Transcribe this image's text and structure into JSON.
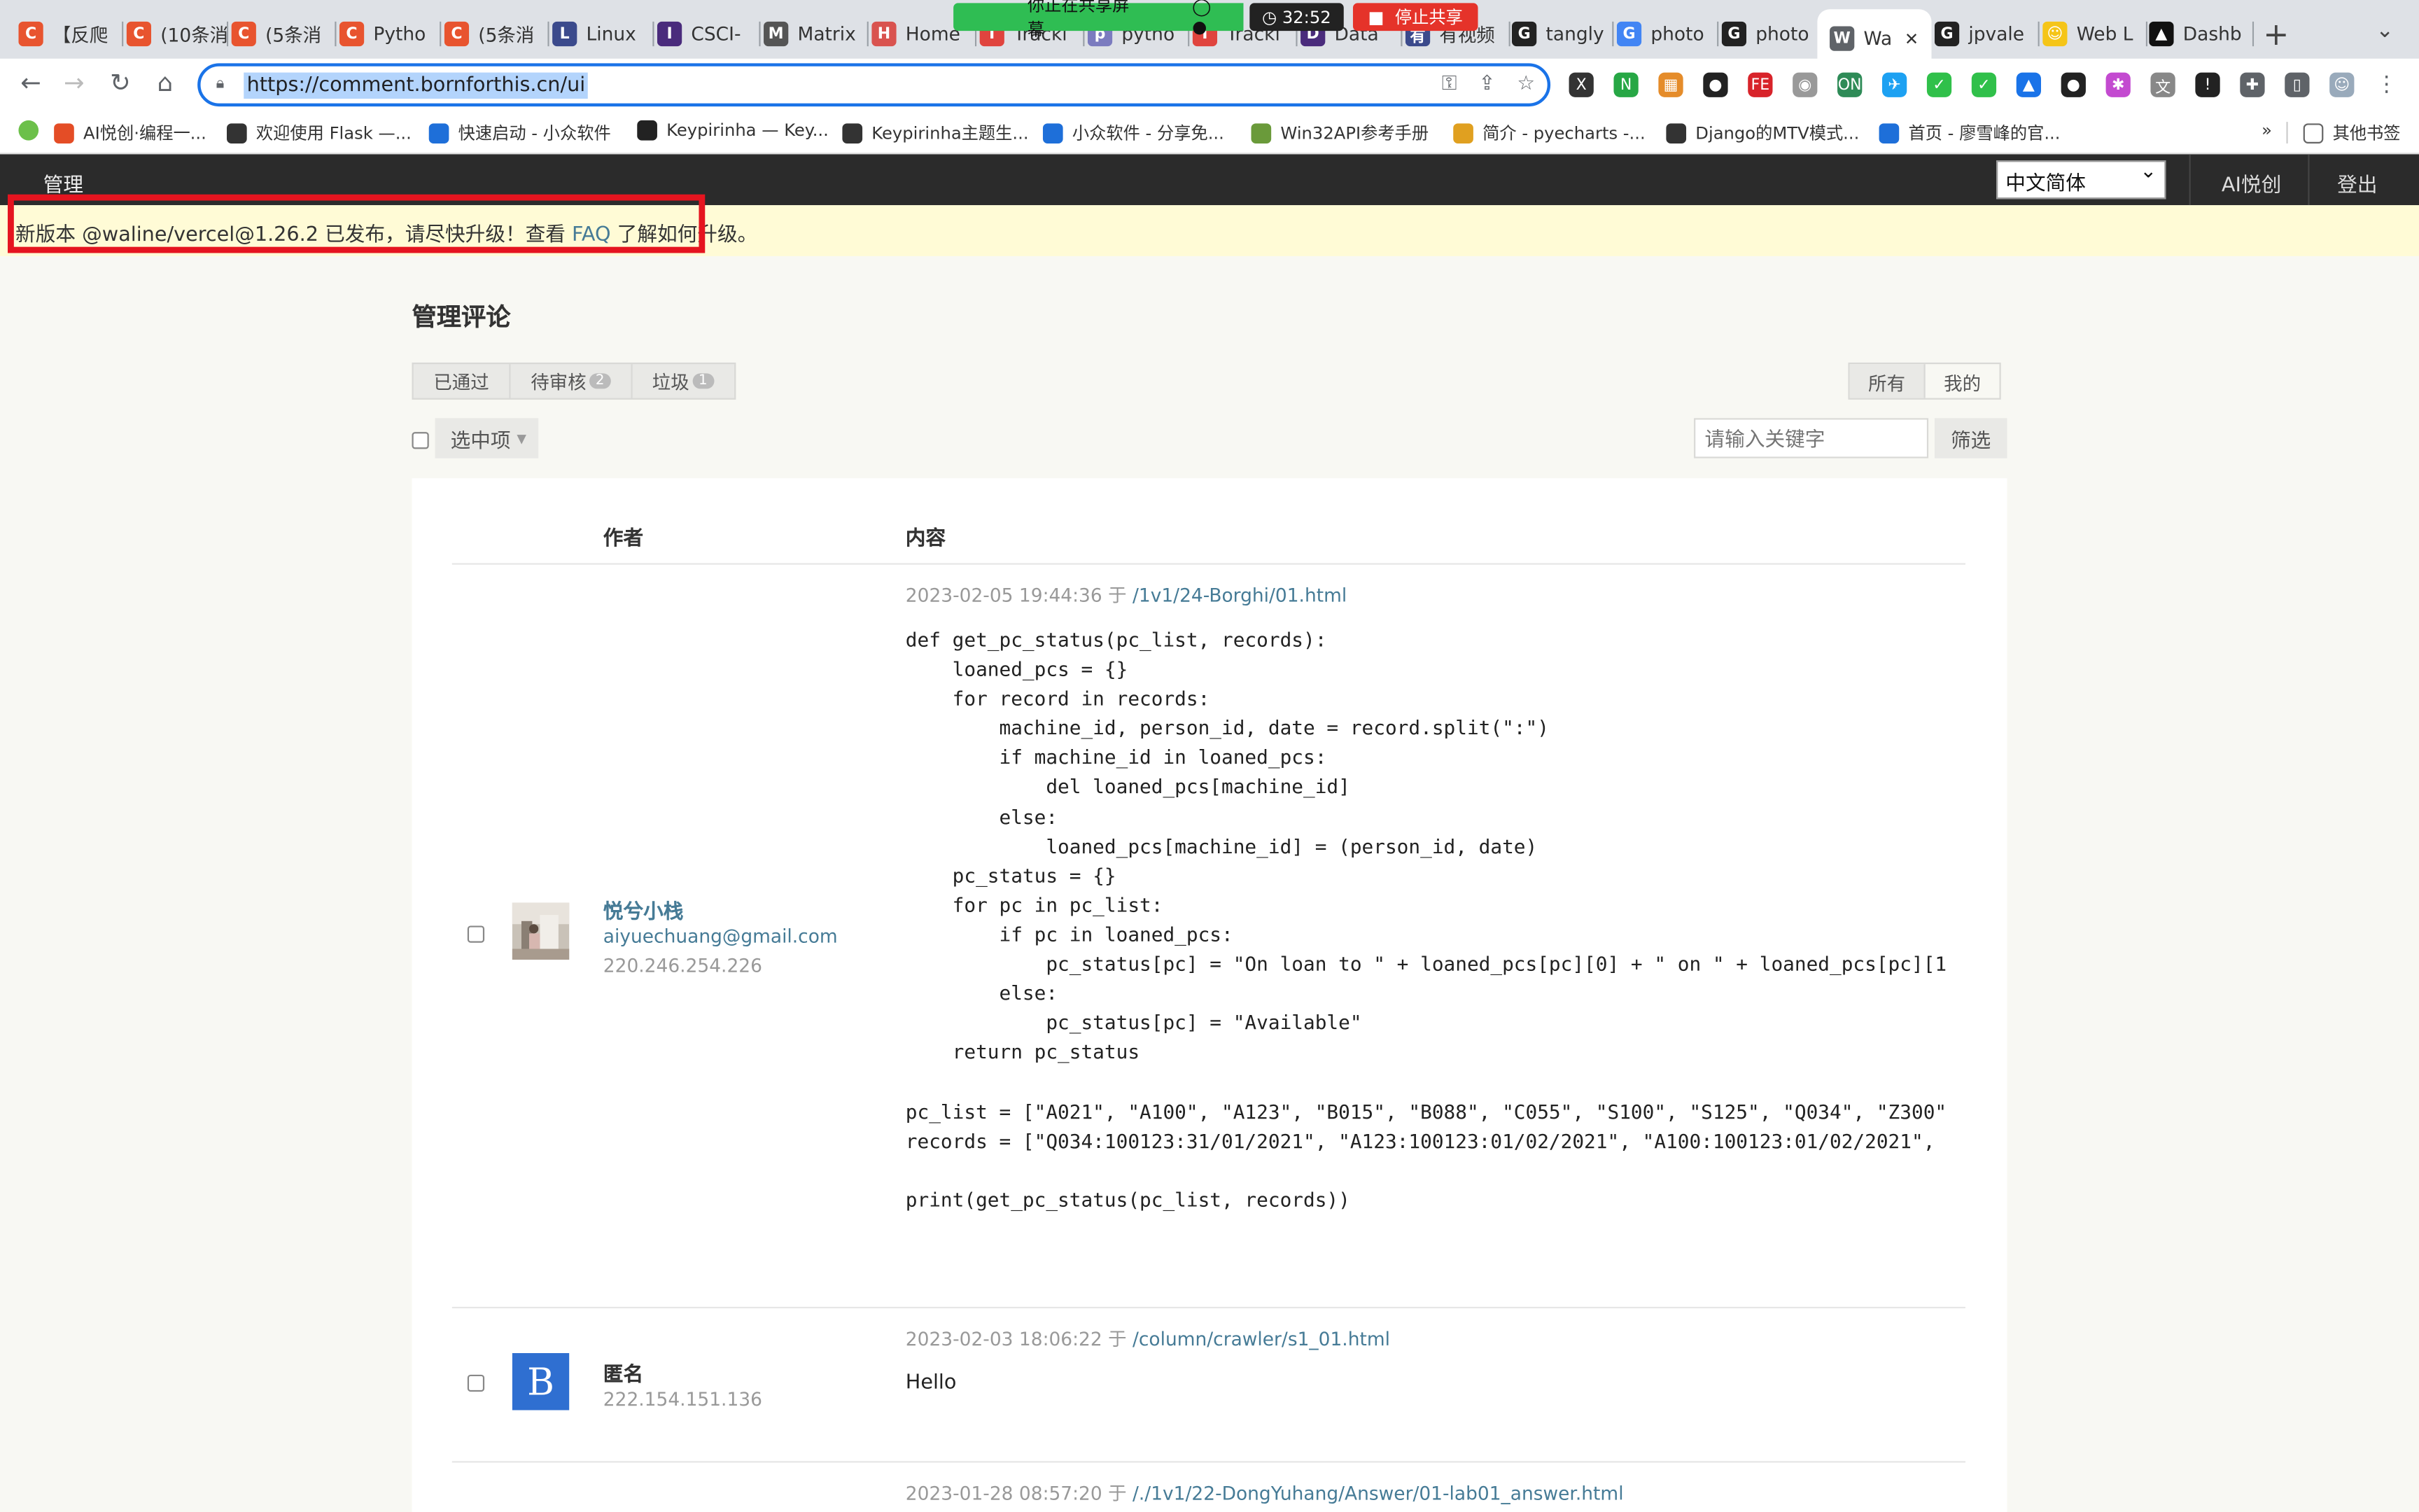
{
  "browser": {
    "tabs": [
      {
        "label": "【反爬",
        "color": "#e8542f",
        "glyph": "C"
      },
      {
        "label": "(10条消",
        "color": "#e8542f",
        "glyph": "C"
      },
      {
        "label": "(5条消",
        "color": "#e8542f",
        "glyph": "C"
      },
      {
        "label": "Pytho",
        "color": "#e8542f",
        "glyph": "C"
      },
      {
        "label": "(5条消",
        "color": "#e8542f",
        "glyph": "C"
      },
      {
        "label": "Linux",
        "color": "#3b4a8c",
        "glyph": "L"
      },
      {
        "label": "CSCI-",
        "color": "#4a2b7c",
        "glyph": "I"
      },
      {
        "label": "Matrix",
        "color": "#555555",
        "glyph": "M"
      },
      {
        "label": "Home",
        "color": "#d9534f",
        "glyph": "H"
      },
      {
        "label": "Tracki",
        "color": "#e0443e",
        "glyph": "T"
      },
      {
        "label": "pytho",
        "color": "#7b7bbf",
        "glyph": "p"
      },
      {
        "label": "Tracki",
        "color": "#e0443e",
        "glyph": "T"
      },
      {
        "label": "Data",
        "color": "#4a2b7c",
        "glyph": "D"
      },
      {
        "label": "有视频",
        "color": "#3b4a8c",
        "glyph": "有"
      },
      {
        "label": "tangly",
        "color": "#222222",
        "glyph": "G"
      },
      {
        "label": "photo",
        "color": "#4285f4",
        "glyph": "G"
      },
      {
        "label": "photo",
        "color": "#222222",
        "glyph": "G"
      },
      {
        "label": "Wa",
        "color": "#5f6368",
        "glyph": "W"
      },
      {
        "label": "jpvale",
        "color": "#222222",
        "glyph": "G"
      },
      {
        "label": "Web L",
        "color": "#f5c518",
        "glyph": "☺"
      },
      {
        "label": "Dashb",
        "color": "#111111",
        "glyph": "▲"
      }
    ],
    "new_tab": "+",
    "share_bar": {
      "message": "你正在共享屏幕",
      "timer": "32:52",
      "stop": "停止共享"
    },
    "url": "https://comment.bornforthis.cn/ui",
    "bookmarks": [
      {
        "label": "AI悦创·编程一...",
        "color": "#e44d26"
      },
      {
        "label": "欢迎使用 Flask —...",
        "color": "#333333"
      },
      {
        "label": "快速启动 - 小众软件",
        "color": "#1e6fd9"
      },
      {
        "label": "Keypirinha — Key...",
        "color": "#222222"
      },
      {
        "label": "Keypirinha主题生...",
        "color": "#333333"
      },
      {
        "label": "小众软件 - 分享免...",
        "color": "#1e6fd9"
      },
      {
        "label": "Win32API参考手册",
        "color": "#6a9a3a"
      },
      {
        "label": "简介 - pyecharts -...",
        "color": "#e0a020"
      },
      {
        "label": "Django的MTV模式...",
        "color": "#333333"
      },
      {
        "label": "首页 - 廖雪峰的官...",
        "color": "#1e6fd9"
      }
    ],
    "bookmarks_more": "»",
    "other_bookmarks": "其他书签"
  },
  "admin": {
    "brand": "管理",
    "language": "中文简体",
    "site_link": "AI悦创",
    "logout": "登出"
  },
  "notice": {
    "prefix": "新版本 @waline/vercel@1.26.2 已发布，请尽快升级！查看 ",
    "link": "FAQ",
    "suffix": " 了解如何升级。"
  },
  "page": {
    "title": "管理评论",
    "status_tabs": [
      {
        "label": "已通过",
        "count": ""
      },
      {
        "label": "待审核",
        "count": "2"
      },
      {
        "label": "垃圾",
        "count": "1"
      }
    ],
    "scope_tabs": [
      "所有",
      "我的"
    ],
    "select_label": "选中项",
    "search_placeholder": "请输入关键字",
    "filter_label": "筛选",
    "columns": {
      "author": "作者",
      "content": "内容"
    }
  },
  "comments": [
    {
      "name": "悦兮小栈",
      "email": "aiyuechuang@gmail.com",
      "ip": "220.246.254.226",
      "date": "2023-02-05 19:44:36 于 ",
      "path": "/1v1/24-Borghi/01.html",
      "code": "def get_pc_status(pc_list, records):\n    loaned_pcs = {}\n    for record in records:\n        machine_id, person_id, date = record.split(\":\")\n        if machine_id in loaned_pcs:\n            del loaned_pcs[machine_id]\n        else:\n            loaned_pcs[machine_id] = (person_id, date)\n    pc_status = {}\n    for pc in pc_list:\n        if pc in loaned_pcs:\n            pc_status[pc] = \"On loan to \" + loaned_pcs[pc][0] + \" on \" + loaned_pcs[pc][1\n        else:\n            pc_status[pc] = \"Available\"\n    return pc_status\n\npc_list = [\"A021\", \"A100\", \"A123\", \"B015\", \"B088\", \"C055\", \"S100\", \"S125\", \"Q034\", \"Z300\"\nrecords = [\"Q034:100123:31/01/2021\", \"A123:100123:01/02/2021\", \"A100:100123:01/02/2021\",\n\nprint(get_pc_status(pc_list, records))"
    },
    {
      "name": "匿名",
      "ip": "222.154.151.136",
      "date": "2023-02-03 18:06:22 于 ",
      "path": "/column/crawler/s1_01.html",
      "text": "Hello"
    },
    {
      "date": "2023-01-28 08:57:20 于 ",
      "path": "/./1v1/22-DongYuhang/Answer/01-lab01_answer.html"
    }
  ]
}
